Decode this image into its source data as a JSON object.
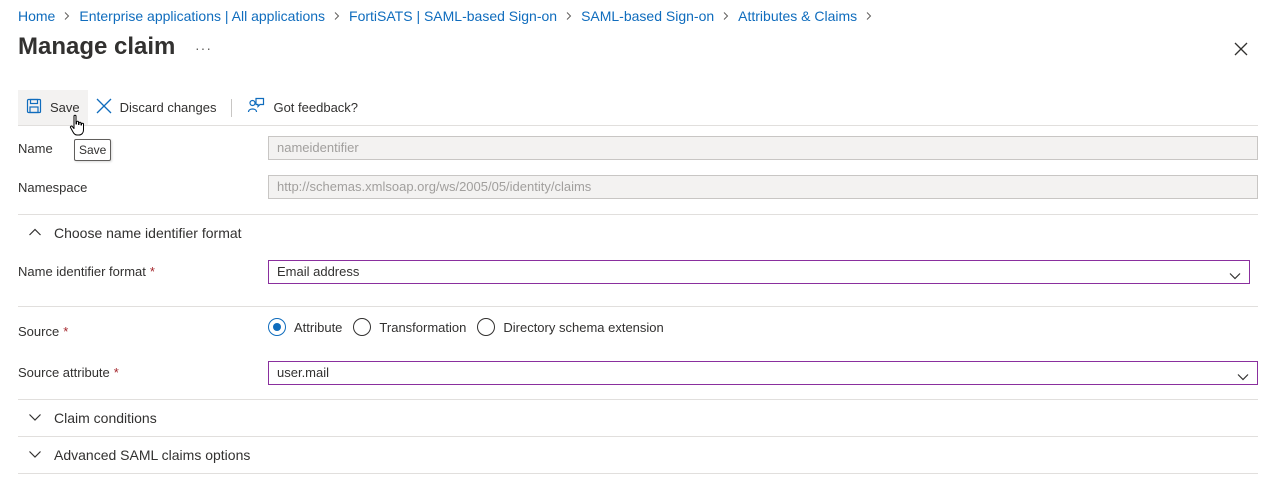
{
  "breadcrumb": [
    "Home",
    "Enterprise applications | All applications",
    "FortiSATS | SAML-based Sign-on",
    "SAML-based Sign-on",
    "Attributes & Claims"
  ],
  "page": {
    "title": "Manage claim",
    "more_label": "···"
  },
  "toolbar": {
    "save_label": "Save",
    "discard_label": "Discard changes",
    "feedback_label": "Got feedback?",
    "tooltip": "Save"
  },
  "form": {
    "name": {
      "label": "Name",
      "value": "nameidentifier"
    },
    "namespace": {
      "label": "Namespace",
      "value": "http://schemas.xmlsoap.org/ws/2005/05/identity/claims"
    },
    "format_section": {
      "label": "Choose name identifier format",
      "expanded": true
    },
    "name_identifier_format": {
      "label": "Name identifier format",
      "required_mark": "*",
      "value": "Email address"
    },
    "source": {
      "label": "Source",
      "required_mark": "*",
      "options": [
        "Attribute",
        "Transformation",
        "Directory schema extension"
      ],
      "selected": "Attribute"
    },
    "source_attribute": {
      "label": "Source attribute",
      "required_mark": "*",
      "value": "user.mail"
    },
    "claim_conditions": {
      "label": "Claim conditions",
      "expanded": false
    },
    "advanced_options": {
      "label": "Advanced SAML claims options",
      "expanded": false
    }
  },
  "colors": {
    "link": "#0f6cbd",
    "required": "#a4262c",
    "focus_border": "#8a2f9e",
    "radio_checked": "#0f6cbd"
  }
}
